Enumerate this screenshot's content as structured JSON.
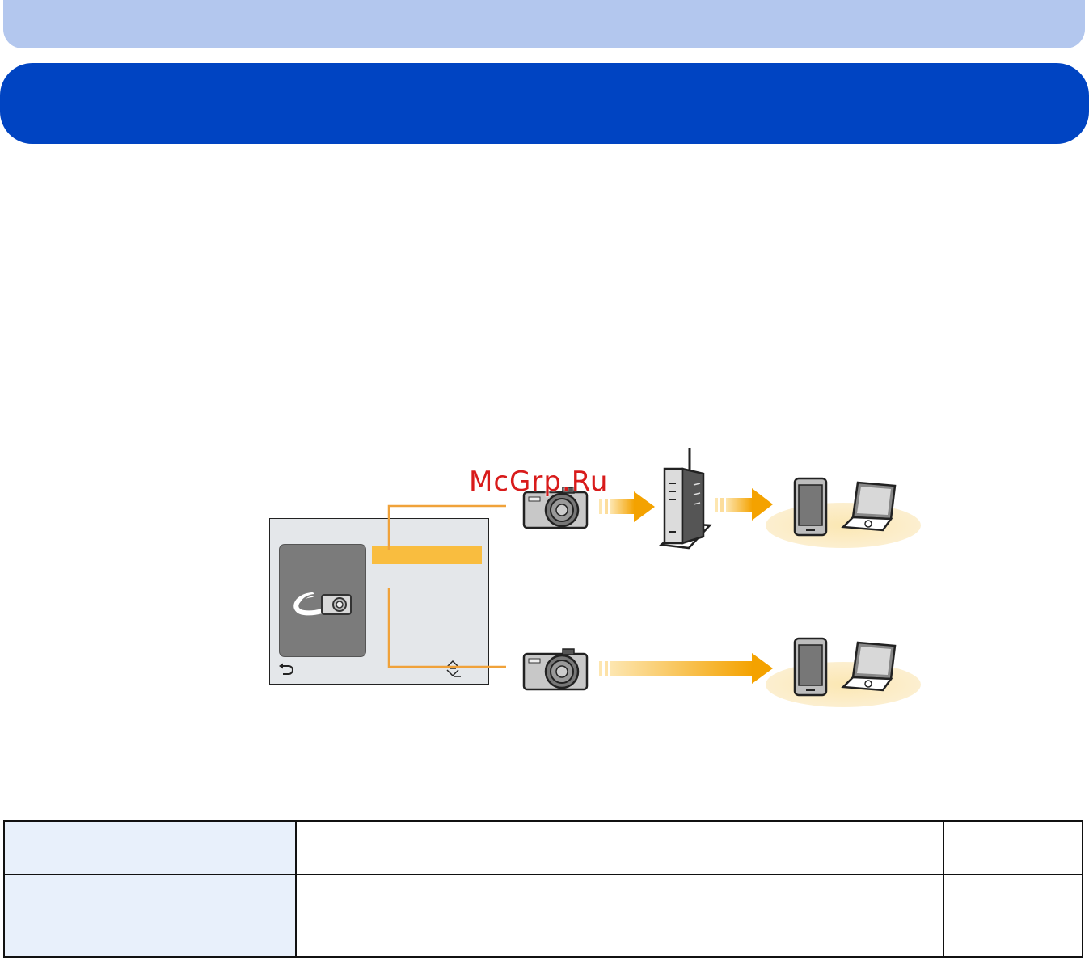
{
  "watermark": "McGrp.Ru",
  "diagram": {
    "upper_route": [
      "camera-icon",
      "arrow-right-icon",
      "wireless-router-icon",
      "arrow-right-icon",
      "smartphone-icon",
      "laptop-icon"
    ],
    "lower_route": [
      "camera-icon",
      "arrow-right-icon",
      "smartphone-icon",
      "laptop-icon"
    ]
  },
  "camera_screen": {
    "panel_icon": "wifi-camera-icon",
    "back_icon": "back-arrow-icon",
    "scroll_icon": "up-down-scroll-icon"
  },
  "colors": {
    "top_band": "#b3c7ee",
    "title_bar": "#0044c2",
    "highlight": "#f9bd3f",
    "arrow": "#f4a200",
    "device_glow": "#fbe9b8",
    "table_header": "#e8f0fb"
  },
  "table": {
    "rows": [
      {
        "label": "",
        "description": "",
        "note": ""
      },
      {
        "label": "",
        "description": "",
        "note": ""
      }
    ]
  }
}
